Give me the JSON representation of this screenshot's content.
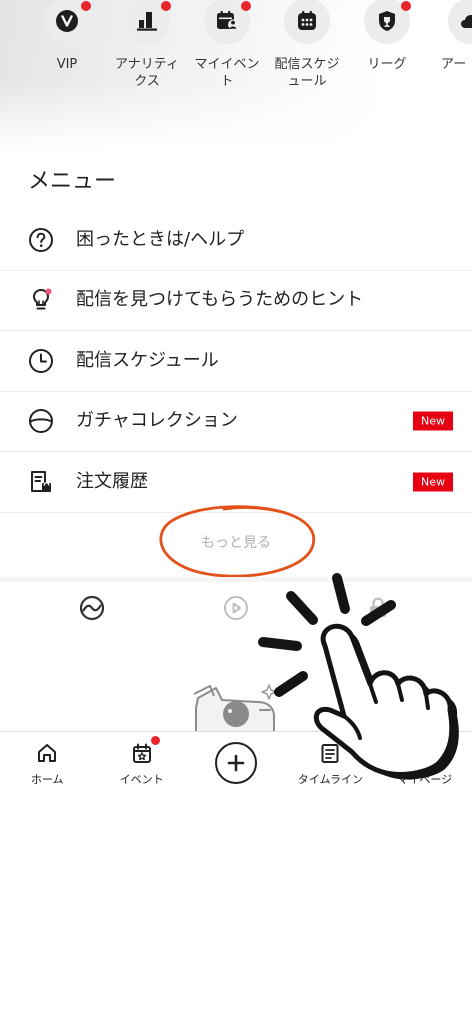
{
  "colors": {
    "accent_red": "#e8252b",
    "new_badge": "#e60012",
    "annotation_orange": "#e4521b",
    "text": "#222222",
    "muted_text": "#b0b0b0"
  },
  "shortcuts": [
    {
      "label": "VIP",
      "icon": "vip-icon",
      "has_badge": true
    },
    {
      "label": "アナリティクス",
      "icon": "analytics-icon",
      "has_badge": true
    },
    {
      "label": "マイイベント",
      "icon": "my-event-icon",
      "has_badge": true
    },
    {
      "label": "配信スケジュール",
      "icon": "schedule-calendar-icon",
      "has_badge": false
    },
    {
      "label": "リーグ",
      "icon": "league-shield-icon",
      "has_badge": true
    },
    {
      "label": "アー",
      "icon": "cloud-icon",
      "has_badge": false
    }
  ],
  "menu": {
    "title": "メニュー",
    "items": [
      {
        "label": "困ったときは/ヘルプ",
        "icon": "help-icon"
      },
      {
        "label": "配信を見つけてもらうためのヒント",
        "icon": "lightbulb-icon",
        "icon_dot": true
      },
      {
        "label": "配信スケジュール",
        "icon": "clock-icon"
      },
      {
        "label": "ガチャコレクション",
        "icon": "gacha-icon",
        "badge": "New"
      },
      {
        "label": "注文履歴",
        "icon": "order-receipt-icon",
        "badge": "New"
      }
    ],
    "more_label": "もっと見る"
  },
  "content_tabs": [
    {
      "icon": "wave-circle-icon",
      "active": true
    },
    {
      "icon": "play-circle-icon",
      "active": false
    },
    {
      "icon": "lock-icon",
      "active": false
    }
  ],
  "bottom_nav": {
    "items": [
      {
        "label": "ホーム",
        "icon": "home-icon"
      },
      {
        "label": "イベント",
        "icon": "event-calendar-icon",
        "has_badge": true
      },
      {
        "icon": "create-plus-icon"
      },
      {
        "label": "タイムライン",
        "icon": "timeline-icon"
      },
      {
        "label": "マイページ",
        "icon": "mypage-icon"
      }
    ]
  },
  "overlay": {
    "hand_icon": "tap-hand-icon",
    "annotation": "orange-ellipse-highlight"
  }
}
